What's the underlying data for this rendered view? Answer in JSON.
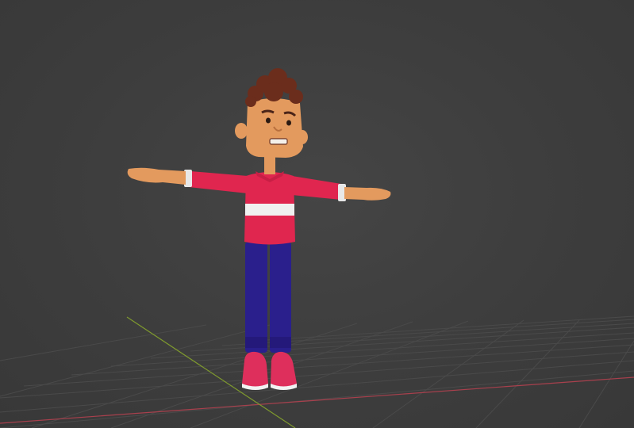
{
  "viewport": {
    "background_color": "#3d3d3d",
    "grid_line_color": "#4a4a4a",
    "x_axis_color": "#a8404d",
    "y_axis_color": "#7f9a2e",
    "show_grid_floor": true,
    "view": "perspective"
  },
  "character": {
    "pose": "T-pose",
    "colors": {
      "skin": "#e39a5e",
      "hair": "#6b2d1c",
      "shirt": "#e0264f",
      "shirt_stripe": "#f0f0f0",
      "pants": "#2a1f8c",
      "shoes": "#de2f5c",
      "shoe_sole": "#f2f2f2",
      "cuffs": "#e8e8e8"
    }
  }
}
